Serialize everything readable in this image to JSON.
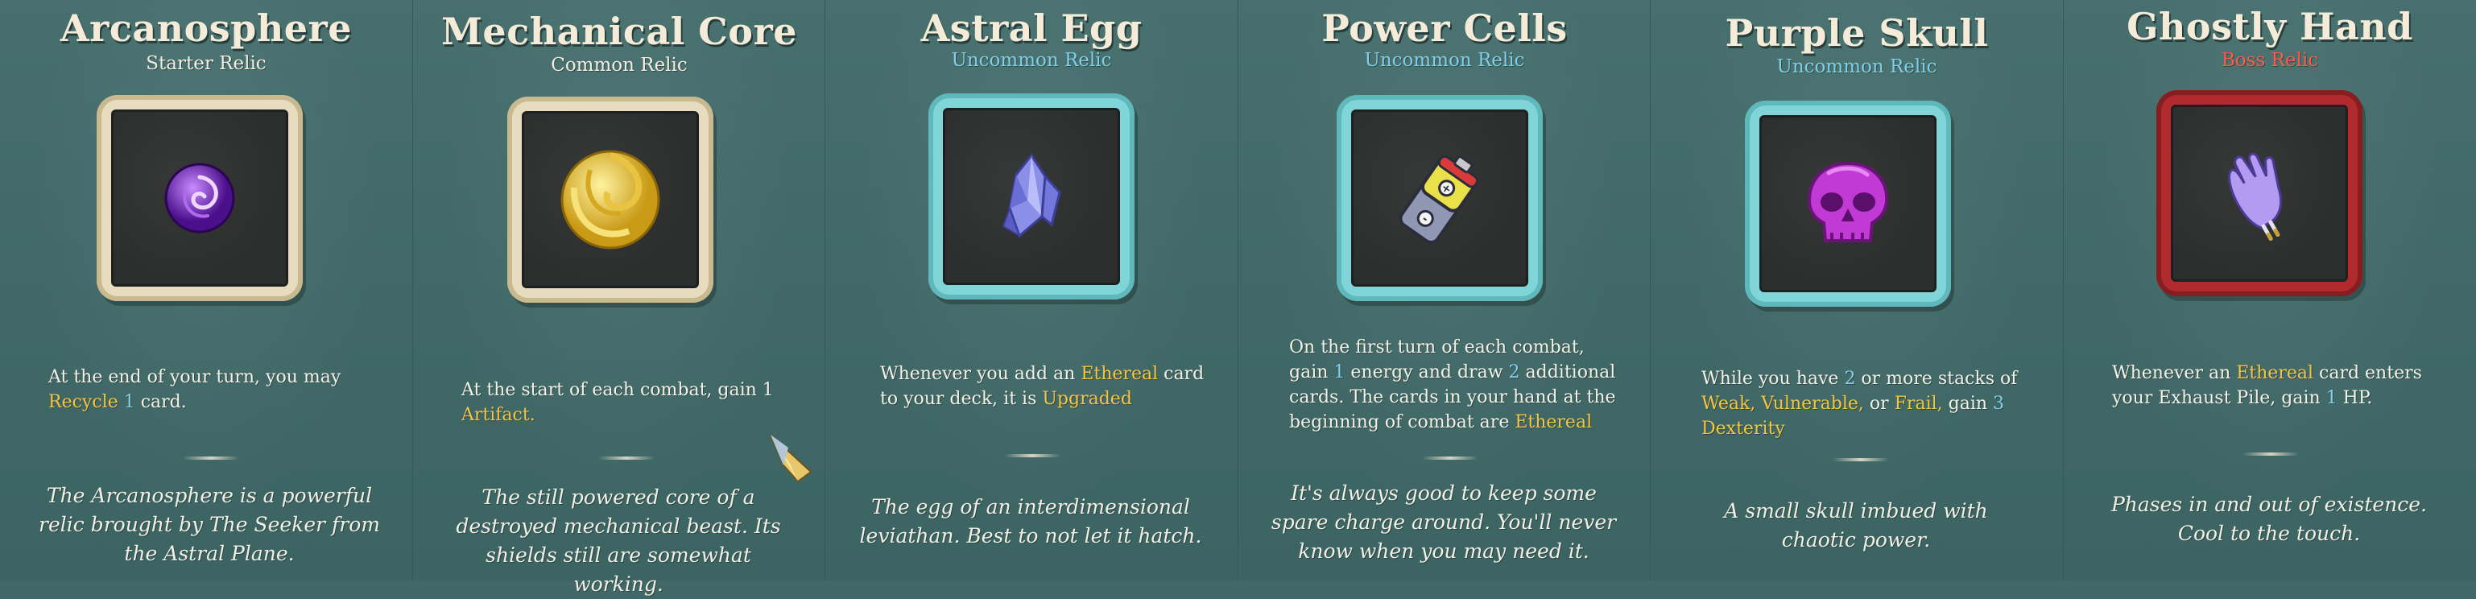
{
  "relics": [
    {
      "name": "Arcanosphere",
      "rarity": "Starter Relic",
      "description": {
        "pre": "At the end of your turn, you may ",
        "kw1": "Recycle",
        "num": " 1",
        "post": " card."
      },
      "flavor": "The Arcanosphere is a powerful relic brought by The Seeker from the Astral Plane.",
      "icon": "purple-orb-icon"
    },
    {
      "name": "Mechanical Core",
      "rarity": "Common Relic",
      "description": {
        "pre": "At the start of each combat, gain 1 ",
        "kw1": "Artifact."
      },
      "flavor": "The still powered core of a destroyed mechanical beast. Its shields still are somewhat working.",
      "icon": "golden-spiral-orb-icon"
    },
    {
      "name": "Astral Egg",
      "rarity": "Uncommon Relic",
      "description": {
        "pre": "Whenever you add an ",
        "kw1": "Ethereal",
        "mid": " card to your deck, it is ",
        "kw2": "Upgraded"
      },
      "flavor": "The egg of an interdimensional leviathan. Best to not let it hatch.",
      "icon": "crystal-egg-icon"
    },
    {
      "name": "Power Cells",
      "rarity": "Uncommon Relic",
      "description": {
        "pre": "On the first turn of each combat, gain ",
        "n1": "1",
        "mid1": " energy and draw ",
        "n2": "2",
        "mid2": " additional cards. The cards in your hand at the beginning of combat are ",
        "kw1": "Ethereal"
      },
      "flavor": "It's always good to keep some spare charge around. You'll never know when you may need it.",
      "icon": "battery-icon"
    },
    {
      "name": "Purple Skull",
      "rarity": "Uncommon Relic",
      "description": {
        "pre": "While you have ",
        "n1": "2",
        "mid1": " or more stacks of ",
        "kw1": "Weak,",
        "kw2": "Vulnerable,",
        "mid2": " or ",
        "kw3": "Frail,",
        "mid3": " gain ",
        "n2": "3",
        "kw4": "Dexterity"
      },
      "flavor": "A small skull imbued with chaotic power.",
      "icon": "purple-skull-icon"
    },
    {
      "name": "Ghostly Hand",
      "rarity": "Boss Relic",
      "description": {
        "pre": "Whenever an ",
        "kw1": "Ethereal",
        "mid1": " card enters your Exhaust Pile, gain ",
        "n1": "1",
        "post": " HP."
      },
      "flavor": "Phases in and out of existence. Cool to the touch.",
      "icon": "ghostly-hand-icon"
    }
  ],
  "colors": {
    "background": "#406967",
    "keyword_gold": "#f5c542",
    "number_blue": "#86cfee",
    "uncommon": "#7fd0e8",
    "boss": "#ff5a4a",
    "frame_starter_common": "#e7dcc0",
    "frame_uncommon": "#7fd5d7",
    "frame_boss": "#b02a2e"
  }
}
